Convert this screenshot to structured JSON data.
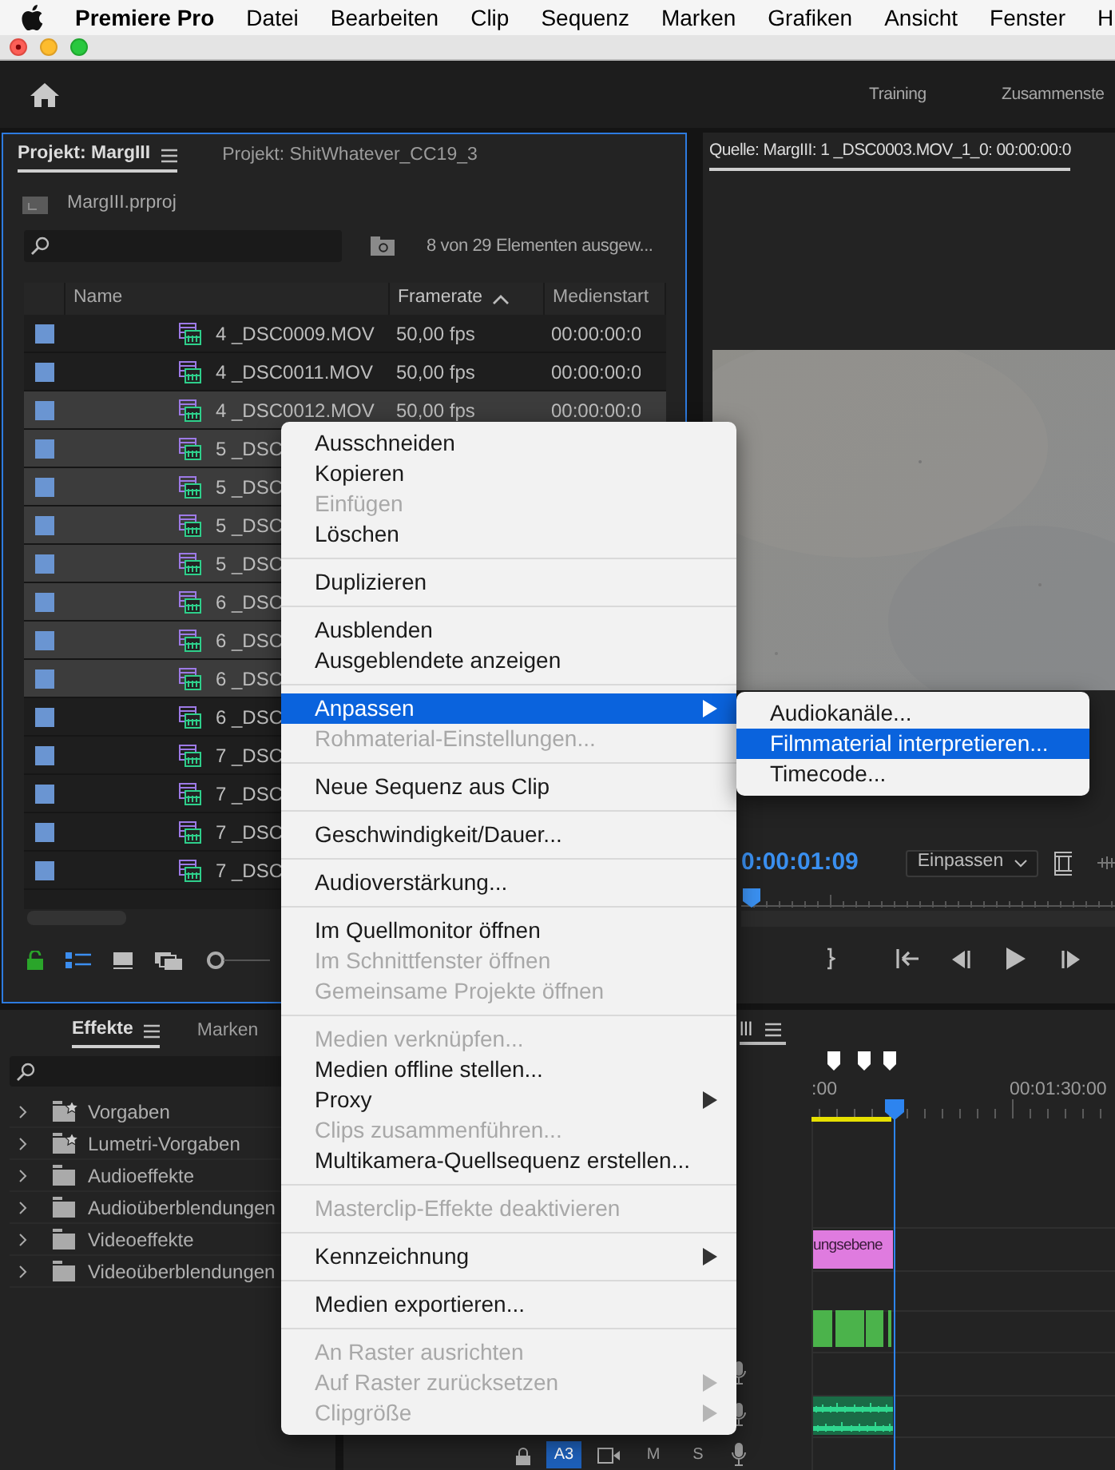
{
  "menu_bar": {
    "items": [
      {
        "label": "Premiere Pro",
        "kind": "app"
      },
      {
        "label": "Datei",
        "kind": "menu"
      },
      {
        "label": "Bearbeiten",
        "kind": "menu"
      },
      {
        "label": "Clip",
        "kind": "menu"
      },
      {
        "label": "Sequenz",
        "kind": "menu"
      },
      {
        "label": "Marken",
        "kind": "menu"
      },
      {
        "label": "Grafiken",
        "kind": "menu"
      },
      {
        "label": "Ansicht",
        "kind": "menu"
      },
      {
        "label": "Fenster",
        "kind": "menu"
      },
      {
        "label": "H",
        "kind": "menu"
      }
    ]
  },
  "header": {
    "workspaces": [
      "Training",
      "Zusammenste"
    ]
  },
  "project_panel": {
    "tabs": [
      {
        "label": "Projekt: MargIII",
        "selected": true
      },
      {
        "label": "Projekt: ShitWhatever_CC19_3",
        "selected": false
      }
    ],
    "project_file": "MargIII.prproj",
    "selection_info": "8 von 29 Elementen ausgew...",
    "table": {
      "columns": [
        {
          "label": "Name",
          "sorted": false
        },
        {
          "label": "Framerate",
          "sorted": true
        },
        {
          "label": "Medienstart",
          "sorted": false
        }
      ],
      "rows": [
        {
          "name": "4 _DSC0009.MOV",
          "framerate": "50,00 fps",
          "media_start": "00:00:00:0",
          "selected": false
        },
        {
          "name": "4 _DSC0011.MOV",
          "framerate": "50,00 fps",
          "media_start": "00:00:00:0",
          "selected": false
        },
        {
          "name": "4 _DSC0012.MOV",
          "framerate": "50,00 fps",
          "media_start": "00:00:00:0",
          "selected": true
        },
        {
          "name": "5 _DSC",
          "selected": true
        },
        {
          "name": "5 _DSC",
          "selected": true
        },
        {
          "name": "5 _DSC",
          "selected": true
        },
        {
          "name": "5 _DSC",
          "selected": true
        },
        {
          "name": "6 _DSC",
          "selected": true
        },
        {
          "name": "6 _DSC",
          "selected": true
        },
        {
          "name": "6 _DSC",
          "selected": true
        },
        {
          "name": "6 _DSC",
          "selected": false
        },
        {
          "name": "7 _DSC",
          "selected": false
        },
        {
          "name": "7 _DSC",
          "selected": false
        },
        {
          "name": "7 _DSC",
          "selected": false
        },
        {
          "name": "7 _DSC",
          "selected": false
        }
      ]
    }
  },
  "source_monitor": {
    "tab": {
      "label": "Quelle: MargIII: 1 _DSC0003.MOV_1_0: 00:00:00:0",
      "selected": true
    },
    "timecode": "0:00:01:09",
    "zoom": "Einpassen"
  },
  "effects_panel": {
    "tabs": [
      {
        "label": "Effekte",
        "selected": true
      },
      {
        "label": "Marken",
        "selected": false
      }
    ],
    "tree": [
      {
        "label": "Vorgaben",
        "kind": "preset",
        "expanded": false
      },
      {
        "label": "Lumetri-Vorgaben",
        "kind": "preset",
        "expanded": false
      },
      {
        "label": "Audioeffekte",
        "kind": "folder",
        "expanded": false
      },
      {
        "label": "Audioüberblendungen",
        "kind": "folder",
        "expanded": false
      },
      {
        "label": "Videoeffekte",
        "kind": "folder",
        "expanded": false
      },
      {
        "label": "Videoüberblendungen",
        "kind": "folder",
        "expanded": false
      }
    ]
  },
  "timeline": {
    "tab": {
      "label": "lll",
      "selected": true
    },
    "ruler_labels": [
      ":00",
      "00:01:30:00"
    ],
    "adjustment_clip": "ungsebene",
    "track_controls": [
      {
        "label": "A3",
        "on": true
      },
      {
        "label": "M",
        "on": false
      },
      {
        "label": "S",
        "on": false
      }
    ]
  },
  "context_menu": {
    "groups": [
      [
        {
          "label": "Ausschneiden",
          "disabled": false,
          "selected": false,
          "submenu": false
        },
        {
          "label": "Kopieren",
          "disabled": false,
          "selected": false,
          "submenu": false
        },
        {
          "label": "Einfügen",
          "disabled": true,
          "selected": false,
          "submenu": false
        },
        {
          "label": "Löschen",
          "disabled": false,
          "selected": false,
          "submenu": false
        }
      ],
      [
        {
          "label": "Duplizieren",
          "disabled": false,
          "selected": false,
          "submenu": false
        }
      ],
      [
        {
          "label": "Ausblenden",
          "disabled": false,
          "selected": false,
          "submenu": false
        },
        {
          "label": "Ausgeblendete anzeigen",
          "disabled": false,
          "selected": false,
          "submenu": false
        }
      ],
      [
        {
          "label": "Anpassen",
          "disabled": false,
          "selected": true,
          "submenu": true
        },
        {
          "label": "Rohmaterial-Einstellungen...",
          "disabled": true,
          "selected": false,
          "submenu": false
        }
      ],
      [
        {
          "label": "Neue Sequenz aus Clip",
          "disabled": false,
          "selected": false,
          "submenu": false
        }
      ],
      [
        {
          "label": "Geschwindigkeit/Dauer...",
          "disabled": false,
          "selected": false,
          "submenu": false
        }
      ],
      [
        {
          "label": "Audioverstärkung...",
          "disabled": false,
          "selected": false,
          "submenu": false
        }
      ],
      [
        {
          "label": "Im Quellmonitor öffnen",
          "disabled": false,
          "selected": false,
          "submenu": false
        },
        {
          "label": "Im Schnittfenster öffnen",
          "disabled": true,
          "selected": false,
          "submenu": false
        },
        {
          "label": "Gemeinsame Projekte öffnen",
          "disabled": true,
          "selected": false,
          "submenu": false
        }
      ],
      [
        {
          "label": "Medien verknüpfen...",
          "disabled": true,
          "selected": false,
          "submenu": false
        },
        {
          "label": "Medien offline stellen...",
          "disabled": false,
          "selected": false,
          "submenu": false
        },
        {
          "label": "Proxy",
          "disabled": false,
          "selected": false,
          "submenu": true
        },
        {
          "label": "Clips zusammenführen...",
          "disabled": true,
          "selected": false,
          "submenu": false
        },
        {
          "label": "Multikamera-Quellsequenz erstellen...",
          "disabled": false,
          "selected": false,
          "submenu": false
        }
      ],
      [
        {
          "label": "Masterclip-Effekte deaktivieren",
          "disabled": true,
          "selected": false,
          "submenu": false
        }
      ],
      [
        {
          "label": "Kennzeichnung",
          "disabled": false,
          "selected": false,
          "submenu": true
        }
      ],
      [
        {
          "label": "Medien exportieren...",
          "disabled": false,
          "selected": false,
          "submenu": false
        }
      ],
      [
        {
          "label": "An Raster ausrichten",
          "disabled": true,
          "selected": false,
          "submenu": false
        },
        {
          "label": "Auf Raster zurücksetzen",
          "disabled": true,
          "selected": false,
          "submenu": true
        },
        {
          "label": "Clipgröße",
          "disabled": true,
          "selected": false,
          "submenu": true
        }
      ]
    ]
  },
  "submenu": {
    "items": [
      {
        "label": "Audiokanäle...",
        "selected": false
      },
      {
        "label": "Filmmaterial interpretieren...",
        "selected": true
      },
      {
        "label": "Timecode...",
        "selected": false
      }
    ]
  }
}
